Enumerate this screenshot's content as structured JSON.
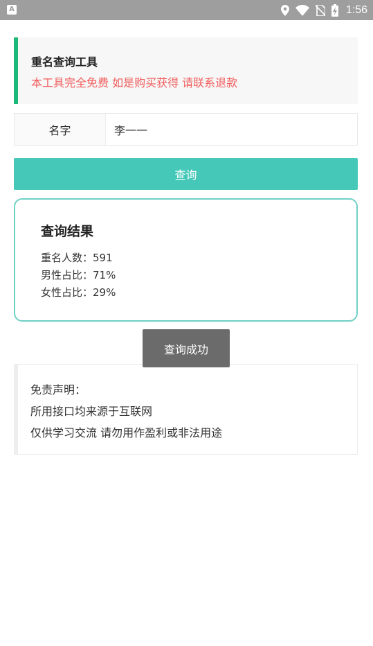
{
  "status_bar": {
    "app_icon_letter": "A",
    "time": "1:56",
    "icons": [
      "location-icon",
      "wifi-icon",
      "no-sim-icon",
      "battery-charging-icon"
    ]
  },
  "notice": {
    "title": "重名查询工具",
    "subtitle": "本工具完全免费 如是购买获得 请联系退款",
    "accent_color": "#1bb978",
    "subtitle_color": "#f25c5c"
  },
  "form": {
    "name_label": "名字",
    "name_value": "李一一"
  },
  "query_button": {
    "label": "查询",
    "color": "#45c8b8"
  },
  "result": {
    "title": "查询结果",
    "count_line": "重名人数：591",
    "male_line": "男性占比：71%",
    "female_line": "女性占比：29%",
    "border_color": "#6ed0c4"
  },
  "toast": {
    "text": "查询成功"
  },
  "disclaimer": {
    "heading": "免责声明：",
    "line1": "所用接口均来源于互联网",
    "line2": "仅供学习交流 请勿用作盈利或非法用途"
  }
}
